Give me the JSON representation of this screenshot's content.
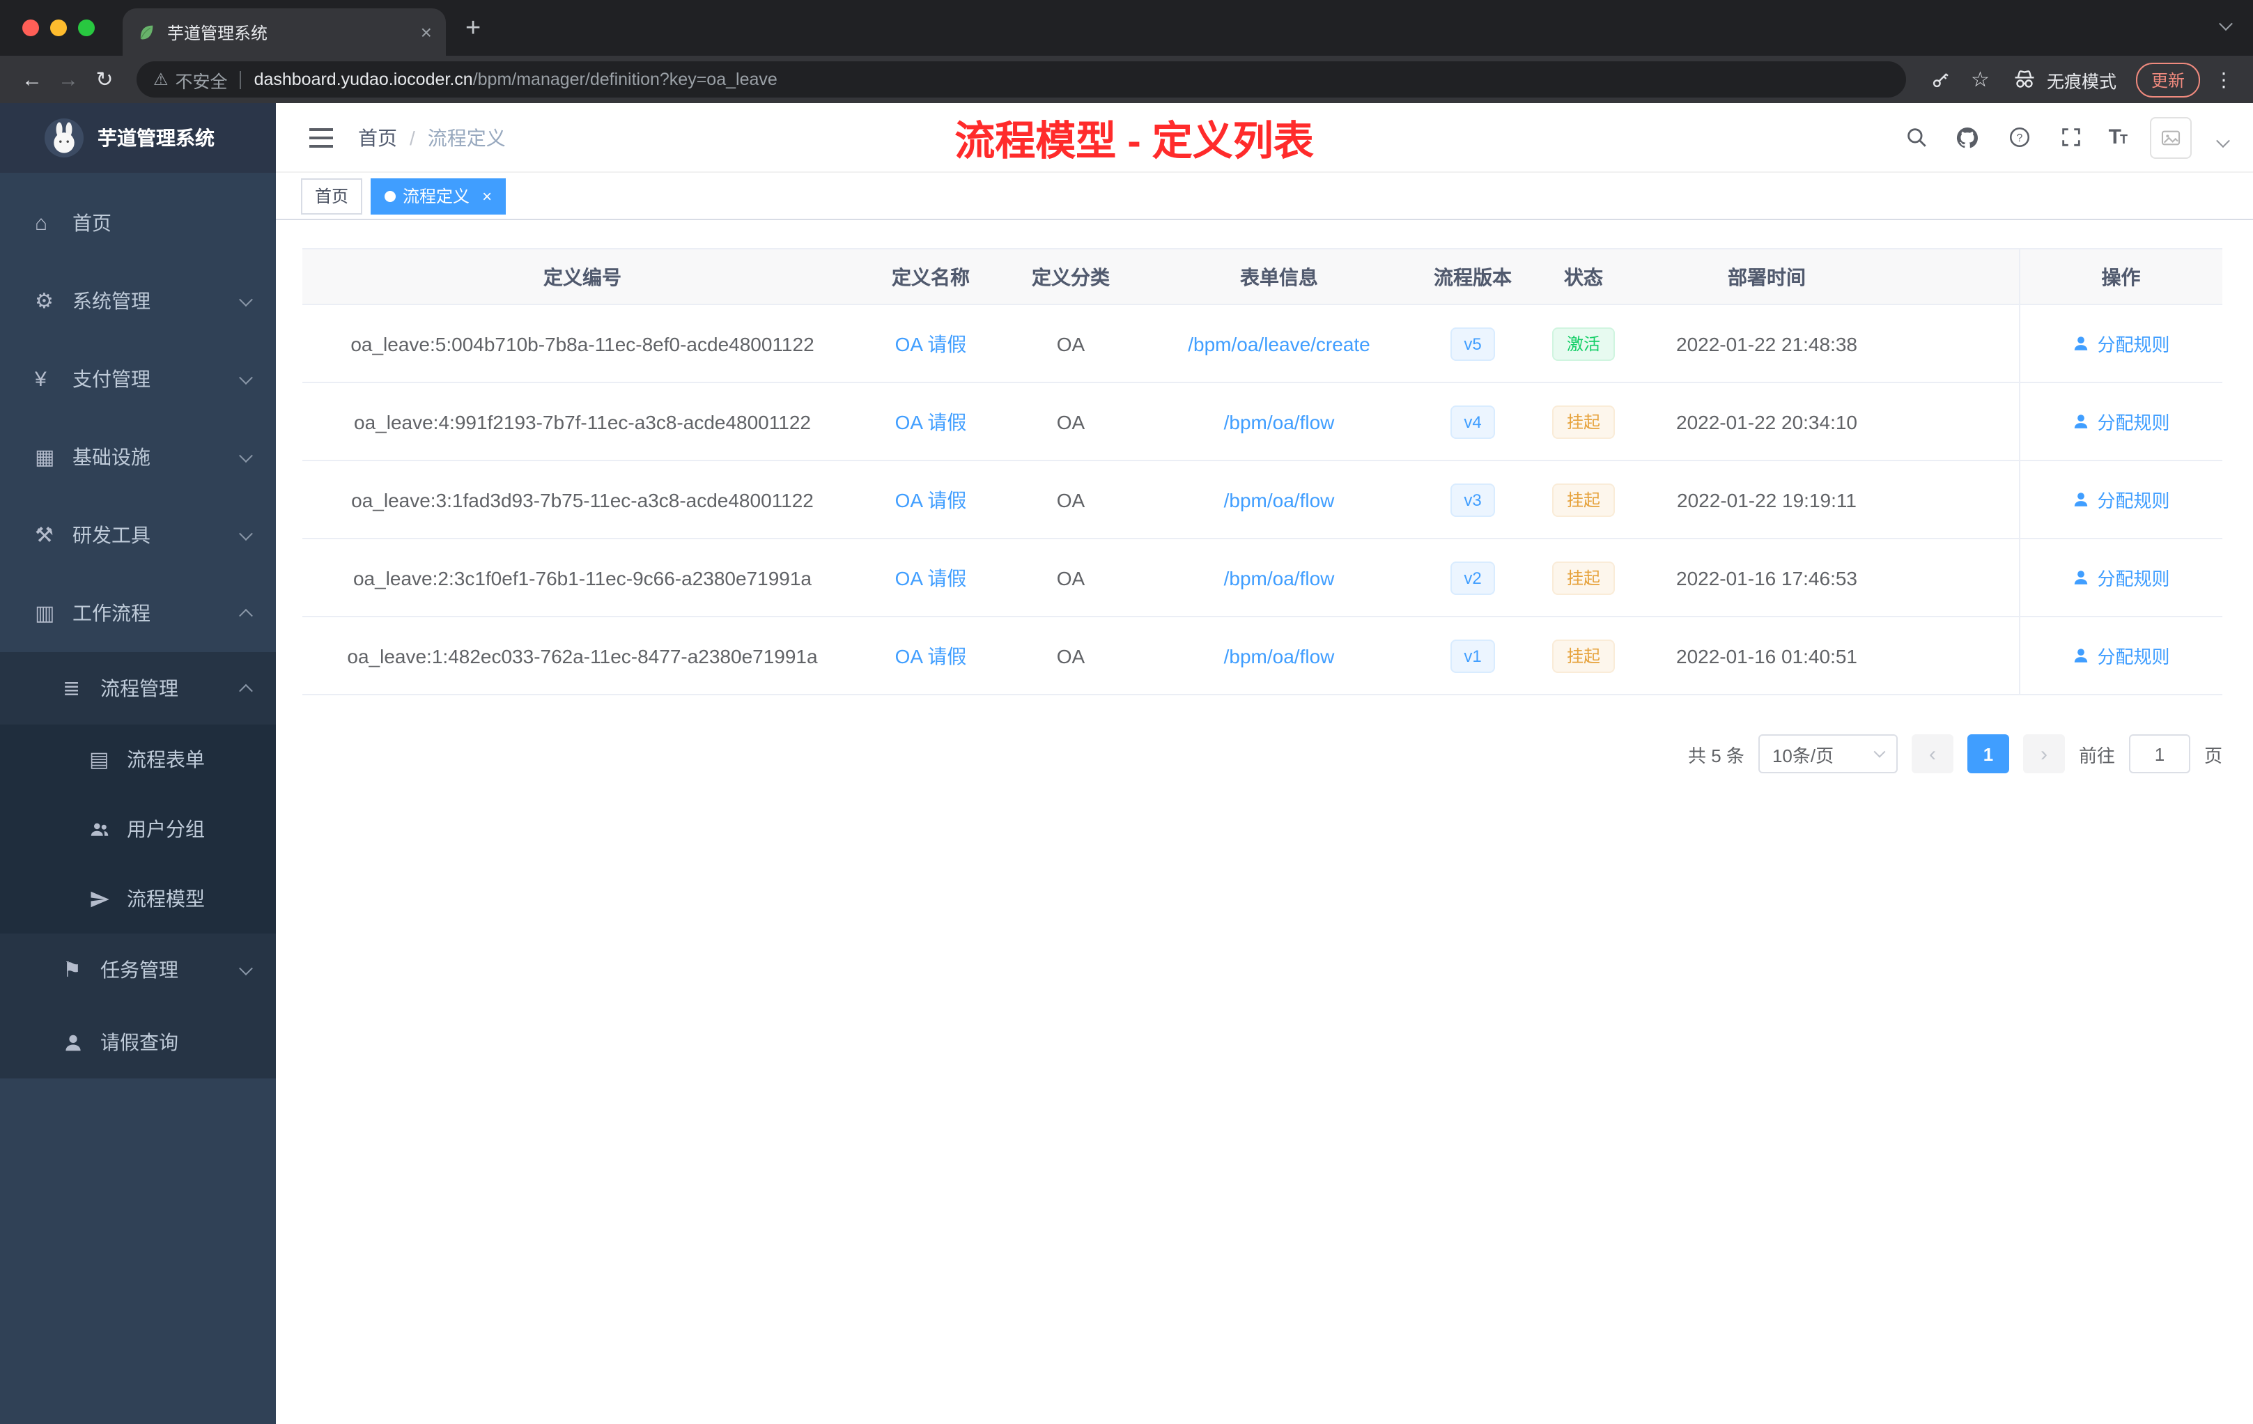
{
  "colors": {
    "accent": "#409eff",
    "link": "#409eff",
    "success_text": "#13ce66",
    "success_bg": "#e7faf0",
    "warning_text": "#e6a23c",
    "warning_bg": "#fdf6ec",
    "annotation_red": "#ff2b2b",
    "sidebar_bg": "#304156",
    "traffic_red": "#ff5f57",
    "traffic_yellow": "#febc2e",
    "traffic_green": "#28c840"
  },
  "icons": {
    "home": "⌂",
    "system": "⚙",
    "payment": "¥",
    "infra": "▦",
    "devtools": "⚒",
    "workflow": "▥",
    "process_mgmt": "≣",
    "process_form": "▤",
    "task_mgmt": "⚑",
    "warning": "⚠",
    "star": "☆",
    "back": "←",
    "forward": "→",
    "reload": "↻",
    "menu_dots": "⋮",
    "close": "×",
    "new_tab": "+",
    "pager_prev": "‹",
    "pager_next": "›",
    "question": "?",
    "font_size": "T"
  },
  "browser": {
    "tab_title": "芋道管理系统",
    "security_label": "不安全",
    "url_host": "dashboard.yudao.iocoder.cn",
    "url_path": "/bpm/manager/definition?key=oa_leave",
    "incognito_label": "无痕模式",
    "update_button": "更新"
  },
  "sidebar": {
    "title": "芋道管理系统",
    "menu": {
      "home": "首页",
      "system": "系统管理",
      "payment": "支付管理",
      "infra": "基础设施",
      "devtools": "研发工具",
      "workflow": "工作流程",
      "process_mgmt": "流程管理",
      "process_form": "流程表单",
      "user_group": "用户分组",
      "process_model": "流程模型",
      "task_mgmt": "任务管理",
      "leave_query": "请假查询"
    }
  },
  "header": {
    "breadcrumb_home": "首页",
    "breadcrumb_sep": "/",
    "breadcrumb_current": "流程定义",
    "annotation": "流程模型 - 定义列表"
  },
  "tags": {
    "home": "首页",
    "active": "流程定义"
  },
  "table": {
    "columns": [
      "定义编号",
      "定义名称",
      "定义分类",
      "表单信息",
      "流程版本",
      "状态",
      "部署时间",
      "操作"
    ],
    "rows": [
      {
        "id": "oa_leave:5:004b710b-7b8a-11ec-8ef0-acde48001122",
        "name": "OA 请假",
        "category": "OA",
        "form": "/bpm/oa/leave/create",
        "version": "v5",
        "status": "激活",
        "time": "2022-01-22 21:48:38",
        "action": "分配规则"
      },
      {
        "id": "oa_leave:4:991f2193-7b7f-11ec-a3c8-acde48001122",
        "name": "OA 请假",
        "category": "OA",
        "form": "/bpm/oa/flow",
        "version": "v4",
        "status": "挂起",
        "time": "2022-01-22 20:34:10",
        "action": "分配规则"
      },
      {
        "id": "oa_leave:3:1fad3d93-7b75-11ec-a3c8-acde48001122",
        "name": "OA 请假",
        "category": "OA",
        "form": "/bpm/oa/flow",
        "version": "v3",
        "status": "挂起",
        "time": "2022-01-22 19:19:11",
        "action": "分配规则"
      },
      {
        "id": "oa_leave:2:3c1f0ef1-76b1-11ec-9c66-a2380e71991a",
        "name": "OA 请假",
        "category": "OA",
        "form": "/bpm/oa/flow",
        "version": "v2",
        "status": "挂起",
        "time": "2022-01-16 17:46:53",
        "action": "分配规则"
      },
      {
        "id": "oa_leave:1:482ec033-762a-11ec-8477-a2380e71991a",
        "name": "OA 请假",
        "category": "OA",
        "form": "/bpm/oa/flow",
        "version": "v1",
        "status": "挂起",
        "time": "2022-01-16 01:40:51",
        "action": "分配规则"
      }
    ]
  },
  "pagination": {
    "total": "共 5 条",
    "page_size": "10条/页",
    "current_page": "1",
    "goto_label": "前往",
    "goto_value": "1",
    "page_unit": "页"
  }
}
